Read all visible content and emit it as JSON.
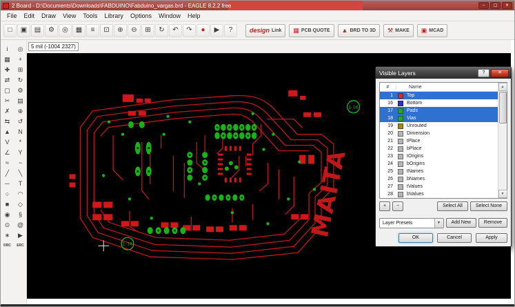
{
  "window": {
    "title": "2 Board - D:\\Documents\\Downloads\\FABDUINO\\Fabduino_vargas.brd - EAGLE 8.2.2 free",
    "minimize": "–",
    "maximize": "▢",
    "close": "✕"
  },
  "menu": [
    {
      "id": "file",
      "label": "File"
    },
    {
      "id": "edit",
      "label": "Edit"
    },
    {
      "id": "draw",
      "label": "Draw"
    },
    {
      "id": "view",
      "label": "View"
    },
    {
      "id": "tools",
      "label": "Tools"
    },
    {
      "id": "library",
      "label": "Library"
    },
    {
      "id": "options",
      "label": "Options"
    },
    {
      "id": "window",
      "label": "Window"
    },
    {
      "id": "help",
      "label": "Help"
    }
  ],
  "toolbar": {
    "icons": [
      {
        "id": "open",
        "glyph": "□"
      },
      {
        "id": "save",
        "glyph": "▣"
      },
      {
        "id": "print",
        "glyph": "▤"
      },
      {
        "id": "cam-processor",
        "glyph": "⚙"
      },
      {
        "id": "drill",
        "glyph": "◎"
      },
      {
        "id": "grid",
        "glyph": "▦"
      },
      {
        "id": "layer-settings",
        "glyph": "≡"
      },
      {
        "id": "zoom-fit",
        "glyph": "⊡"
      },
      {
        "id": "zoom-in",
        "glyph": "⊕"
      },
      {
        "id": "zoom-out",
        "glyph": "⊖"
      },
      {
        "id": "zoom-select",
        "glyph": "⊞"
      },
      {
        "id": "redraw",
        "glyph": "↻"
      },
      {
        "id": "undo",
        "glyph": "↶"
      },
      {
        "id": "redo",
        "glyph": "↷"
      },
      {
        "id": "stop",
        "glyph": "●",
        "cls": "red"
      },
      {
        "id": "go",
        "glyph": "▶"
      },
      {
        "id": "help",
        "glyph": "?"
      }
    ],
    "partner_buttons": [
      {
        "id": "design-link",
        "label_a": "design",
        "label_b": "Link"
      },
      {
        "id": "pcb-quote",
        "icon": "▦",
        "label_b": "PCB QUOTE"
      },
      {
        "id": "brd-to-3d",
        "icon": "▲",
        "label_b": "BRD TO 3D"
      },
      {
        "id": "make",
        "icon": "⚒",
        "label_b": "MAKE"
      },
      {
        "id": "mcad",
        "icon": "▣",
        "label_b": "MCAD"
      }
    ]
  },
  "statusbar": {
    "coords": "5 mil (-1004 2327)"
  },
  "palette": [
    {
      "id": "info",
      "glyph": "i"
    },
    {
      "id": "show",
      "glyph": "◎"
    },
    {
      "id": "display",
      "glyph": "▦"
    },
    {
      "id": "mark",
      "glyph": "+"
    },
    {
      "id": "move",
      "glyph": "✚"
    },
    {
      "id": "copy",
      "glyph": "⊞"
    },
    {
      "id": "mirror",
      "glyph": "⇄"
    },
    {
      "id": "rotate",
      "glyph": "↻"
    },
    {
      "id": "group",
      "glyph": "▢"
    },
    {
      "id": "change",
      "glyph": "⚙"
    },
    {
      "id": "cut",
      "glyph": "✂"
    },
    {
      "id": "paste",
      "glyph": "▤"
    },
    {
      "id": "delete",
      "glyph": "✗"
    },
    {
      "id": "add",
      "glyph": "⊕"
    },
    {
      "id": "pinswap",
      "glyph": "⇆"
    },
    {
      "id": "replace",
      "glyph": "↺"
    },
    {
      "id": "lock",
      "glyph": "▲"
    },
    {
      "id": "name",
      "glyph": "N"
    },
    {
      "id": "value",
      "glyph": "V"
    },
    {
      "id": "smash",
      "glyph": "*"
    },
    {
      "id": "miter",
      "glyph": "∠"
    },
    {
      "id": "split",
      "glyph": "Y"
    },
    {
      "id": "optimize",
      "glyph": "≈"
    },
    {
      "id": "meander",
      "glyph": "~"
    },
    {
      "id": "route",
      "glyph": "╱"
    },
    {
      "id": "ripup",
      "glyph": "╲"
    },
    {
      "id": "wire",
      "glyph": "─"
    },
    {
      "id": "text",
      "glyph": "T"
    },
    {
      "id": "circle",
      "glyph": "○"
    },
    {
      "id": "arc",
      "glyph": "◠"
    },
    {
      "id": "rect",
      "glyph": "■"
    },
    {
      "id": "polygon",
      "glyph": "◇"
    },
    {
      "id": "via",
      "glyph": "◉"
    },
    {
      "id": "signal",
      "glyph": "§"
    },
    {
      "id": "hole",
      "glyph": "⊙"
    },
    {
      "id": "attribute",
      "glyph": "@"
    },
    {
      "id": "ratsnest",
      "glyph": "∗"
    },
    {
      "id": "autorouter",
      "glyph": "▶"
    },
    {
      "id": "drc",
      "glyph": "DRC",
      "cls": "txt"
    },
    {
      "id": "erc",
      "glyph": "ERC",
      "cls": "txt"
    }
  ],
  "canvas": {
    "marker_top": "1-16",
    "marker_bottom": "1-16",
    "board_label": "MAITA"
  },
  "colors": {
    "trace_red": "#bb1a1a",
    "pad_green": "#19b219",
    "smd_red": "#d01818",
    "selection_blue": "#2f71d1"
  },
  "dialog": {
    "title": "Visible Layers",
    "help_button": "?",
    "close_button": "✕",
    "header_num": "#",
    "header_name": "Name",
    "scroll_up": "▲",
    "scroll_down": "▼",
    "dropdown_arrow": "▼",
    "rows": [
      {
        "id": "top",
        "num": "1",
        "name": "Top",
        "color": "#c83232",
        "selected": true
      },
      {
        "id": "bottom",
        "num": "16",
        "name": "Bottom",
        "color": "#3232c8",
        "selected": false
      },
      {
        "id": "pads",
        "num": "17",
        "name": "Pads",
        "color": "#28a428",
        "selected": true
      },
      {
        "id": "vias",
        "num": "18",
        "name": "Vias",
        "color": "#28a428",
        "selected": true
      },
      {
        "id": "unrouted",
        "num": "19",
        "name": "Unrouted",
        "color": "#a08820",
        "selected": false
      },
      {
        "id": "dimension",
        "num": "20",
        "name": "Dimension",
        "color": "#b4b4b4",
        "selected": false
      },
      {
        "id": "tplace",
        "num": "21",
        "name": "tPlace",
        "color": "#b4b4b4",
        "selected": false
      },
      {
        "id": "bplace",
        "num": "22",
        "name": "bPlace",
        "color": "#b4b4b4",
        "selected": false
      },
      {
        "id": "torigins",
        "num": "23",
        "name": "tOrigins",
        "color": "#b4b4b4",
        "selected": false
      },
      {
        "id": "borigins",
        "num": "24",
        "name": "bOrigins",
        "color": "#b4b4b4",
        "selected": false
      },
      {
        "id": "tnames",
        "num": "25",
        "name": "tNames",
        "color": "#b4b4b4",
        "selected": false
      },
      {
        "id": "bnames",
        "num": "26",
        "name": "bNames",
        "color": "#b4b4b4",
        "selected": false
      },
      {
        "id": "tvalues",
        "num": "27",
        "name": "tValues",
        "color": "#b4b4b4",
        "selected": false
      },
      {
        "id": "bvalues",
        "num": "28",
        "name": "bValues",
        "color": "#b4b4b4",
        "selected": false
      }
    ],
    "plus": "+",
    "minus": "−",
    "select_all": "Select All",
    "select_none": "Select None",
    "layer_presets": "Layer Presets",
    "add_new": "Add New",
    "remove": "Remove",
    "ok": "OK",
    "cancel": "Cancel",
    "apply": "Apply"
  }
}
